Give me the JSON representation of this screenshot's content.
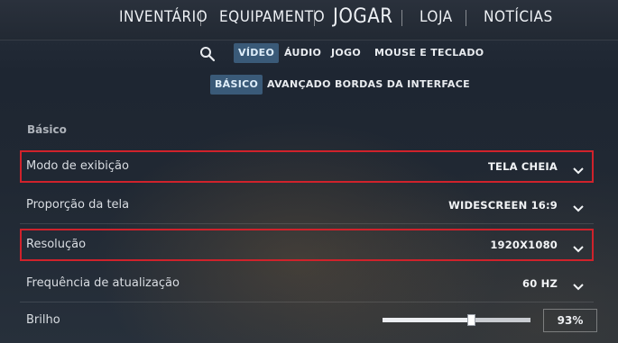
{
  "top_nav": {
    "items": [
      "INVENTÁRIO",
      "EQUIPAMENTO",
      "JOGAR",
      "LOJA",
      "NOTÍCIAS"
    ]
  },
  "settings_tabs": {
    "search_icon": "search-icon",
    "items": [
      "VÍDEO",
      "ÁUDIO",
      "JOGO",
      "MOUSE E TECLADO"
    ],
    "active": "VÍDEO"
  },
  "sub_tabs": {
    "items": [
      "BÁSICO",
      "AVANÇADO",
      "BORDAS DA INTERFACE"
    ],
    "active": "BÁSICO"
  },
  "section": {
    "title": "Básico"
  },
  "rows": [
    {
      "label": "Modo de exibição",
      "value": "TELA CHEIA",
      "highlighted": true
    },
    {
      "label": "Proporção da tela",
      "value": "WIDESCREEN 16:9",
      "highlighted": false
    },
    {
      "label": "Resolução",
      "value": "1920X1080",
      "highlighted": true
    },
    {
      "label": "Frequência de atualização",
      "value": "60 HZ",
      "highlighted": false
    }
  ],
  "brightness": {
    "label": "Brilho",
    "value_text": "93%",
    "level": 0.93
  },
  "colors": {
    "highlight_border": "#d0222b",
    "active_tab_bg": "#3a5a78"
  }
}
